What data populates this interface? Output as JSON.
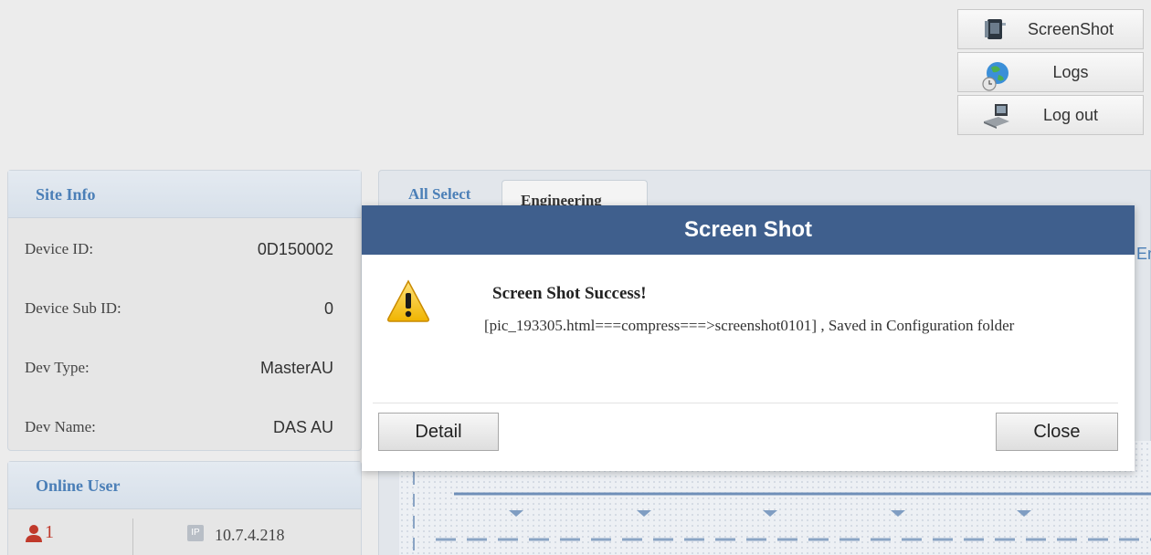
{
  "actions": {
    "screenshot": "ScreenShot",
    "logs": "Logs",
    "logout": "Log out"
  },
  "site_info": {
    "title": "Site Info",
    "rows": [
      {
        "label": "Device ID:",
        "value": "0D150002"
      },
      {
        "label": "Device Sub ID:",
        "value": "0"
      },
      {
        "label": "Dev Type:",
        "value": "MasterAU"
      },
      {
        "label": "Dev Name:",
        "value": "DAS AU"
      }
    ]
  },
  "online_user": {
    "title": "Online User",
    "count": "1",
    "ip_badge": "IP",
    "ip": "10.7.4.218"
  },
  "main": {
    "tab_all": "All Select",
    "tab_engineering": "Engineering",
    "behind_fragment": "En"
  },
  "modal": {
    "title": "Screen Shot",
    "message_title": "Screen Shot Success!",
    "message_body": "[pic_193305.html===compress===>screenshot0101] , Saved in Configuration folder",
    "detail_label": "Detail",
    "close_label": "Close"
  },
  "colors": {
    "modal_header": "#3f5f8d",
    "link_blue": "#4b7fb7",
    "user_red": "#c0392b"
  }
}
